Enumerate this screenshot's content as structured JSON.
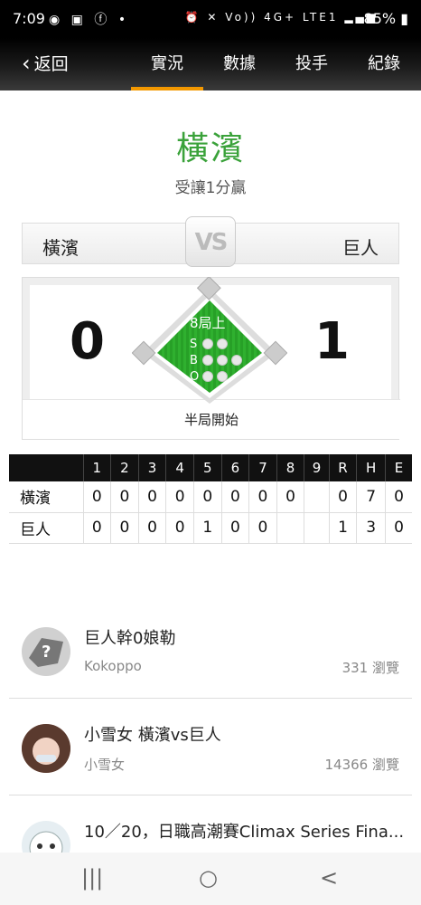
{
  "status_bar": {
    "time": "7:09",
    "left_icons": [
      "line-icon",
      "image-icon",
      "facebook-icon",
      "dot"
    ],
    "right_icons": [
      "alarm-icon",
      "mute-icon",
      "volte-icon",
      "4g-icon",
      "signal-icon"
    ],
    "network_text": "Vo)) 4G+ LTE1",
    "battery": "85%"
  },
  "header": {
    "back_label": "返回",
    "tabs": [
      {
        "label": "實況",
        "active": true
      },
      {
        "label": "數據",
        "active": false
      },
      {
        "label": "投手",
        "active": false
      },
      {
        "label": "紀錄",
        "active": false
      }
    ],
    "accent_color": "#f39800"
  },
  "game": {
    "title": "橫濱",
    "subtitle": "受讓1分贏",
    "title_color": "#3aa23a",
    "away_team": "橫濱",
    "home_team": "巨人",
    "vs_text": "VS",
    "away_score": "0",
    "home_score": "1",
    "inning": "8局上",
    "count_labels": {
      "s": "S",
      "b": "B",
      "o": "O"
    },
    "status": "半局開始"
  },
  "boxscore": {
    "headers": [
      "",
      "1",
      "2",
      "3",
      "4",
      "5",
      "6",
      "7",
      "8",
      "9",
      "R",
      "H",
      "E"
    ],
    "rows": [
      [
        "橫濱",
        "0",
        "0",
        "0",
        "0",
        "0",
        "0",
        "0",
        "0",
        "",
        "0",
        "7",
        "0"
      ],
      [
        "巨人",
        "0",
        "0",
        "0",
        "0",
        "1",
        "0",
        "0",
        "",
        "",
        "1",
        "3",
        "0"
      ]
    ]
  },
  "posts": [
    {
      "title": "巨人幹0娘勒",
      "author": "Kokoppo",
      "views": "331 瀏覽",
      "avatar": "unknown-avatar-icon"
    },
    {
      "title": "小雪女 橫濱vs巨人",
      "author": "小雪女",
      "views": "14366 瀏覽",
      "avatar": "user-photo-avatar"
    },
    {
      "title": "10／20，日職高潮賽Climax Series Fina...",
      "author": "",
      "views": "",
      "avatar": "mascot-avatar"
    }
  ],
  "nav_bar": {
    "recents": "|||",
    "home": "○",
    "back": "<"
  }
}
